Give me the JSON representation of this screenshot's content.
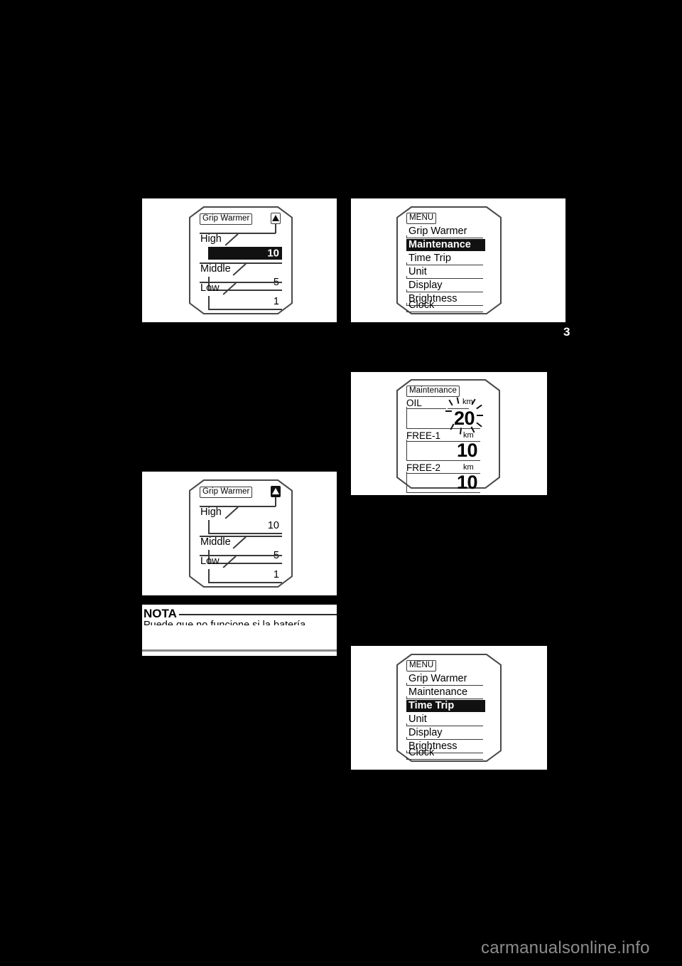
{
  "page": {
    "number": "3",
    "watermark": "carmanualsonline.info",
    "background_color": "#000000",
    "figure_background_color": "#ffffff"
  },
  "figures": {
    "grip_warmer_high_selected": {
      "title_chip": "Grip Warmer",
      "indicator_icon": "up-triangle-icon",
      "indicator_state": "outline",
      "rows": [
        {
          "label": "High",
          "value": "10",
          "highlighted": true
        },
        {
          "label": "Middle",
          "value": "5",
          "highlighted": false
        },
        {
          "label": "Low",
          "value": "1",
          "highlighted": false
        }
      ]
    },
    "grip_warmer_unselected": {
      "title_chip": "Grip Warmer",
      "indicator_icon": "up-triangle-icon",
      "indicator_state": "filled",
      "rows": [
        {
          "label": "High",
          "value": "10",
          "highlighted": false
        },
        {
          "label": "Middle",
          "value": "5",
          "highlighted": false
        },
        {
          "label": "Low",
          "value": "1",
          "highlighted": false
        }
      ]
    },
    "menu_maintenance_selected": {
      "title_chip": "MENU",
      "items": [
        {
          "label": "Grip Warmer",
          "selected": false
        },
        {
          "label": "Maintenance",
          "selected": true
        },
        {
          "label": "Time Trip",
          "selected": false
        },
        {
          "label": "Unit",
          "selected": false
        },
        {
          "label": "Display",
          "selected": false
        },
        {
          "label": "Brightness",
          "selected": false
        },
        {
          "label": "Clock",
          "selected": false
        }
      ]
    },
    "menu_time_trip_selected": {
      "title_chip": "MENU",
      "items": [
        {
          "label": "Grip Warmer",
          "selected": false
        },
        {
          "label": "Maintenance",
          "selected": false
        },
        {
          "label": "Time Trip",
          "selected": true
        },
        {
          "label": "Unit",
          "selected": false
        },
        {
          "label": "Display",
          "selected": false
        },
        {
          "label": "Brightness",
          "selected": false
        },
        {
          "label": "Clock",
          "selected": false
        }
      ]
    },
    "maintenance": {
      "title_chip": "Maintenance",
      "rows": [
        {
          "label": "OIL",
          "unit": "km",
          "value": "20",
          "flashing": true
        },
        {
          "label": "FREE-1",
          "unit": "km",
          "value": "10",
          "flashing": false
        },
        {
          "label": "FREE-2",
          "unit": "km",
          "value": "10",
          "flashing": false
        }
      ]
    }
  },
  "nota": {
    "title": "NOTA",
    "body": "Puede que no funcione si la batería"
  }
}
